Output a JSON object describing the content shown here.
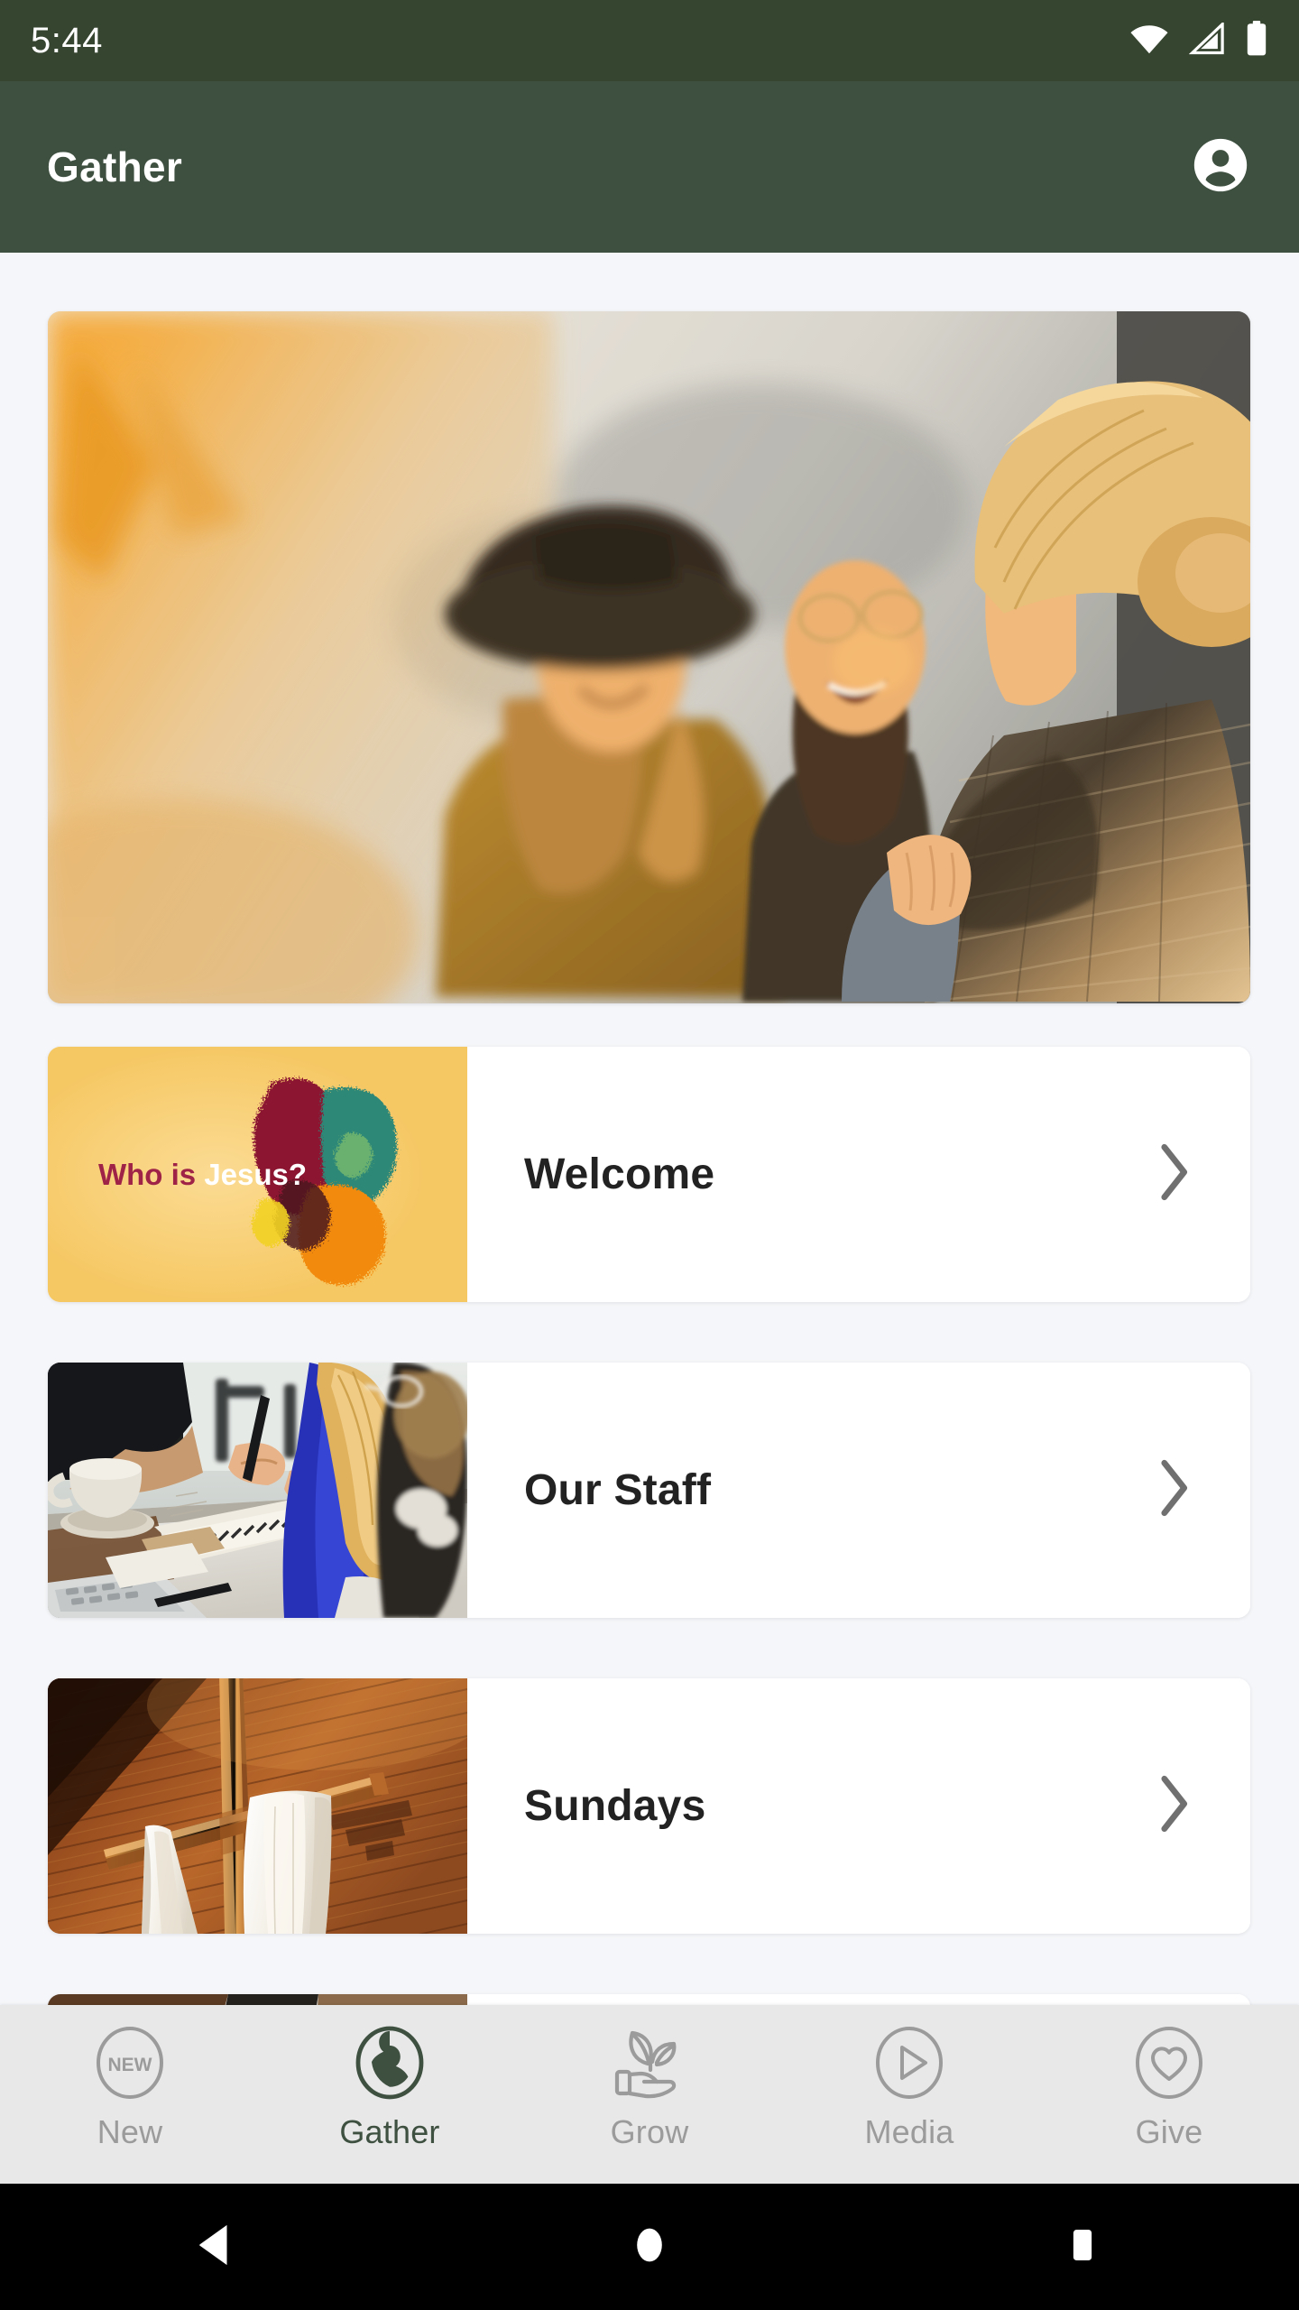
{
  "status_bar": {
    "time": "5:44",
    "icons": [
      "wifi-icon",
      "cellular-signal-icon",
      "battery-icon"
    ]
  },
  "app_bar": {
    "title": "Gather",
    "avatar_icon": "account-circle-icon"
  },
  "theme": {
    "status_bar_bg": "#36452F",
    "app_bar_bg": "#3E5040",
    "page_bg": "#F4F6F9",
    "card_bg": "#FFFFFF",
    "nav_bg": "#E8E8E8",
    "accent_green": "#3E5040",
    "inactive_grey": "#9B9B9B",
    "label_text": "#222222",
    "chevron_grey": "#707070"
  },
  "hero": {
    "name": "hero-image",
    "alt": "Three women laughing together in warm golden sunlight"
  },
  "cards": [
    {
      "label": "Welcome",
      "thumbnail": "who-is-jesus-graphic",
      "thumb_text_a": "Who is ",
      "thumb_text_b": "Jesus?",
      "chevron": "chevron-right-icon"
    },
    {
      "label": "Our Staff",
      "thumbnail": "staff-meeting-photo",
      "chevron": "chevron-right-icon"
    },
    {
      "label": "Sundays",
      "thumbnail": "wooden-cross-photo",
      "chevron": "chevron-right-icon"
    }
  ],
  "bottom_nav": {
    "active": "Gather",
    "items": [
      {
        "label": "New",
        "icon": "new-badge-icon",
        "active": false
      },
      {
        "label": "Gather",
        "icon": "person-circle-icon",
        "active": true
      },
      {
        "label": "Grow",
        "icon": "hand-plant-icon",
        "active": false
      },
      {
        "label": "Media",
        "icon": "play-circle-icon",
        "active": false
      },
      {
        "label": "Give",
        "icon": "heart-circle-icon",
        "active": false
      }
    ],
    "new_badge_text": "NEW"
  },
  "system_nav": {
    "buttons": [
      {
        "name": "back-button",
        "icon": "triangle-back-icon"
      },
      {
        "name": "home-button",
        "icon": "circle-home-icon"
      },
      {
        "name": "recents-button",
        "icon": "square-recents-icon"
      }
    ]
  }
}
